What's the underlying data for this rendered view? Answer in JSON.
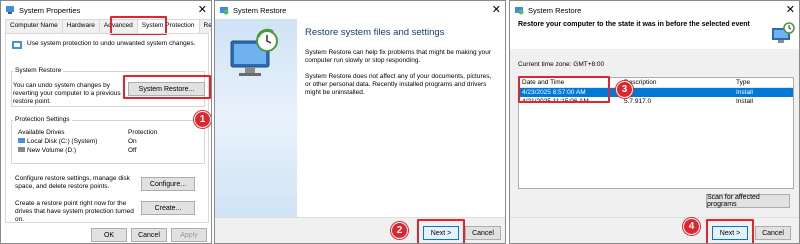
{
  "panel1": {
    "title": "System Properties",
    "tabs": [
      "Computer Name",
      "Hardware",
      "Advanced",
      "System Protection",
      "Remote"
    ],
    "active_tab": "System Protection",
    "intro": "Use system protection to undo unwanted system changes.",
    "restore_group": "System Restore",
    "restore_text": "You can undo system changes by reverting your computer to a previous restore point.",
    "restore_button": "System Restore...",
    "protection_group": "Protection Settings",
    "columns": [
      "Available Drives",
      "Protection"
    ],
    "drives": [
      {
        "name": "Local Disk (C:) (System)",
        "protection": "On"
      },
      {
        "name": "New Volume (D:)",
        "protection": "Off"
      }
    ],
    "configure_text": "Configure restore settings, manage disk space, and delete restore points.",
    "configure_button": "Configure...",
    "create_text": "Create a restore point right now for the drives that have system protection turned on.",
    "create_button": "Create...",
    "ok": "OK",
    "cancel": "Cancel",
    "apply": "Apply",
    "badge": "1"
  },
  "panel2": {
    "title": "System Restore",
    "heading": "Restore system files and settings",
    "para1": "System Restore can help fix problems that might be making your computer run slowly or stop responding.",
    "para2": "System Restore does not affect any of your documents, pictures, or other personal data. Recently installed programs and drivers might be uninstalled.",
    "next": "Next >",
    "cancel": "Cancel",
    "badge": "2"
  },
  "panel3": {
    "title": "System Restore",
    "heading": "Restore your computer to the state it was in before the selected event",
    "timezone": "Current time zone: GMT+8:00",
    "columns": [
      "Date and Time",
      "Description",
      "Type"
    ],
    "rows": [
      {
        "date": "4/23/2025 8:57:00 AM",
        "desc": "",
        "type": "Install"
      },
      {
        "date": "4/21/2025 11:15:06 AM",
        "desc": "5.7.917.0",
        "type": "Install"
      }
    ],
    "scan_button": "Scan for affected programs",
    "next": "Next >",
    "cancel": "Cancel",
    "badge_top": "3",
    "badge_bottom": "4"
  },
  "colors": {
    "highlight": "#e0252e",
    "selection": "#0078d7"
  }
}
